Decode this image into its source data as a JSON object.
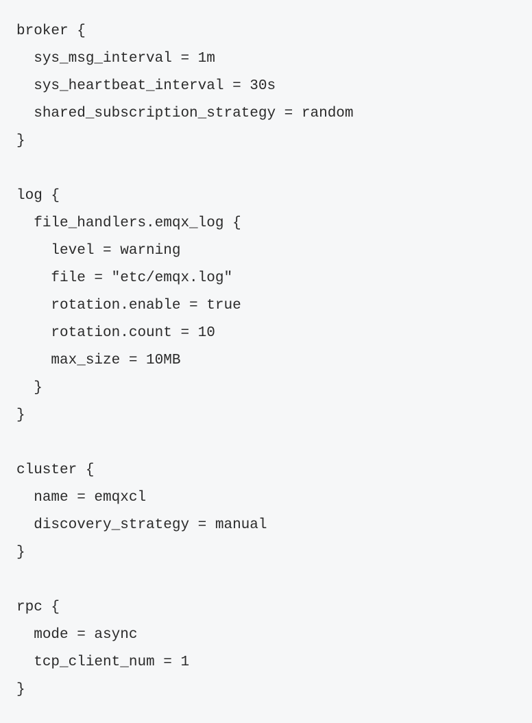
{
  "config": {
    "broker": {
      "block_open": "broker {",
      "items": [
        "sys_msg_interval = 1m",
        "sys_heartbeat_interval = 30s",
        "shared_subscription_strategy = random"
      ],
      "block_close": "}"
    },
    "log": {
      "block_open": "log {",
      "handler_open": "file_handlers.emqx_log {",
      "items": [
        "level = warning",
        "file = \"etc/emqx.log\"",
        "rotation.enable = true",
        "rotation.count = 10",
        "max_size = 10MB"
      ],
      "handler_close": "}",
      "block_close": "}"
    },
    "cluster": {
      "block_open": "cluster {",
      "items": [
        "name = emqxcl",
        "discovery_strategy = manual"
      ],
      "block_close": "}"
    },
    "rpc": {
      "block_open": "rpc {",
      "items": [
        "mode = async",
        "tcp_client_num = 1"
      ],
      "block_close": "}"
    }
  }
}
